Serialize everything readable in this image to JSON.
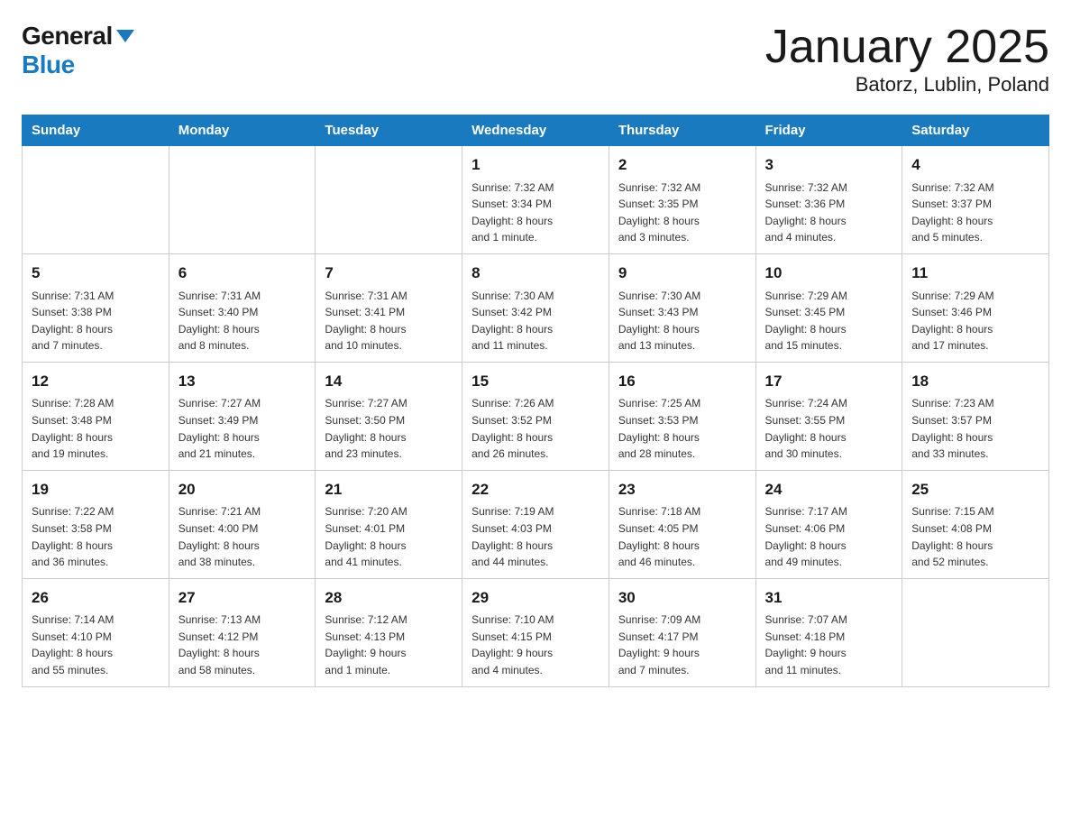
{
  "header": {
    "logo_general": "General",
    "logo_blue": "Blue",
    "month_title": "January 2025",
    "location": "Batorz, Lublin, Poland"
  },
  "days_of_week": [
    "Sunday",
    "Monday",
    "Tuesday",
    "Wednesday",
    "Thursday",
    "Friday",
    "Saturday"
  ],
  "weeks": [
    [
      {
        "num": "",
        "info": ""
      },
      {
        "num": "",
        "info": ""
      },
      {
        "num": "",
        "info": ""
      },
      {
        "num": "1",
        "info": "Sunrise: 7:32 AM\nSunset: 3:34 PM\nDaylight: 8 hours\nand 1 minute."
      },
      {
        "num": "2",
        "info": "Sunrise: 7:32 AM\nSunset: 3:35 PM\nDaylight: 8 hours\nand 3 minutes."
      },
      {
        "num": "3",
        "info": "Sunrise: 7:32 AM\nSunset: 3:36 PM\nDaylight: 8 hours\nand 4 minutes."
      },
      {
        "num": "4",
        "info": "Sunrise: 7:32 AM\nSunset: 3:37 PM\nDaylight: 8 hours\nand 5 minutes."
      }
    ],
    [
      {
        "num": "5",
        "info": "Sunrise: 7:31 AM\nSunset: 3:38 PM\nDaylight: 8 hours\nand 7 minutes."
      },
      {
        "num": "6",
        "info": "Sunrise: 7:31 AM\nSunset: 3:40 PM\nDaylight: 8 hours\nand 8 minutes."
      },
      {
        "num": "7",
        "info": "Sunrise: 7:31 AM\nSunset: 3:41 PM\nDaylight: 8 hours\nand 10 minutes."
      },
      {
        "num": "8",
        "info": "Sunrise: 7:30 AM\nSunset: 3:42 PM\nDaylight: 8 hours\nand 11 minutes."
      },
      {
        "num": "9",
        "info": "Sunrise: 7:30 AM\nSunset: 3:43 PM\nDaylight: 8 hours\nand 13 minutes."
      },
      {
        "num": "10",
        "info": "Sunrise: 7:29 AM\nSunset: 3:45 PM\nDaylight: 8 hours\nand 15 minutes."
      },
      {
        "num": "11",
        "info": "Sunrise: 7:29 AM\nSunset: 3:46 PM\nDaylight: 8 hours\nand 17 minutes."
      }
    ],
    [
      {
        "num": "12",
        "info": "Sunrise: 7:28 AM\nSunset: 3:48 PM\nDaylight: 8 hours\nand 19 minutes."
      },
      {
        "num": "13",
        "info": "Sunrise: 7:27 AM\nSunset: 3:49 PM\nDaylight: 8 hours\nand 21 minutes."
      },
      {
        "num": "14",
        "info": "Sunrise: 7:27 AM\nSunset: 3:50 PM\nDaylight: 8 hours\nand 23 minutes."
      },
      {
        "num": "15",
        "info": "Sunrise: 7:26 AM\nSunset: 3:52 PM\nDaylight: 8 hours\nand 26 minutes."
      },
      {
        "num": "16",
        "info": "Sunrise: 7:25 AM\nSunset: 3:53 PM\nDaylight: 8 hours\nand 28 minutes."
      },
      {
        "num": "17",
        "info": "Sunrise: 7:24 AM\nSunset: 3:55 PM\nDaylight: 8 hours\nand 30 minutes."
      },
      {
        "num": "18",
        "info": "Sunrise: 7:23 AM\nSunset: 3:57 PM\nDaylight: 8 hours\nand 33 minutes."
      }
    ],
    [
      {
        "num": "19",
        "info": "Sunrise: 7:22 AM\nSunset: 3:58 PM\nDaylight: 8 hours\nand 36 minutes."
      },
      {
        "num": "20",
        "info": "Sunrise: 7:21 AM\nSunset: 4:00 PM\nDaylight: 8 hours\nand 38 minutes."
      },
      {
        "num": "21",
        "info": "Sunrise: 7:20 AM\nSunset: 4:01 PM\nDaylight: 8 hours\nand 41 minutes."
      },
      {
        "num": "22",
        "info": "Sunrise: 7:19 AM\nSunset: 4:03 PM\nDaylight: 8 hours\nand 44 minutes."
      },
      {
        "num": "23",
        "info": "Sunrise: 7:18 AM\nSunset: 4:05 PM\nDaylight: 8 hours\nand 46 minutes."
      },
      {
        "num": "24",
        "info": "Sunrise: 7:17 AM\nSunset: 4:06 PM\nDaylight: 8 hours\nand 49 minutes."
      },
      {
        "num": "25",
        "info": "Sunrise: 7:15 AM\nSunset: 4:08 PM\nDaylight: 8 hours\nand 52 minutes."
      }
    ],
    [
      {
        "num": "26",
        "info": "Sunrise: 7:14 AM\nSunset: 4:10 PM\nDaylight: 8 hours\nand 55 minutes."
      },
      {
        "num": "27",
        "info": "Sunrise: 7:13 AM\nSunset: 4:12 PM\nDaylight: 8 hours\nand 58 minutes."
      },
      {
        "num": "28",
        "info": "Sunrise: 7:12 AM\nSunset: 4:13 PM\nDaylight: 9 hours\nand 1 minute."
      },
      {
        "num": "29",
        "info": "Sunrise: 7:10 AM\nSunset: 4:15 PM\nDaylight: 9 hours\nand 4 minutes."
      },
      {
        "num": "30",
        "info": "Sunrise: 7:09 AM\nSunset: 4:17 PM\nDaylight: 9 hours\nand 7 minutes."
      },
      {
        "num": "31",
        "info": "Sunrise: 7:07 AM\nSunset: 4:18 PM\nDaylight: 9 hours\nand 11 minutes."
      },
      {
        "num": "",
        "info": ""
      }
    ]
  ]
}
